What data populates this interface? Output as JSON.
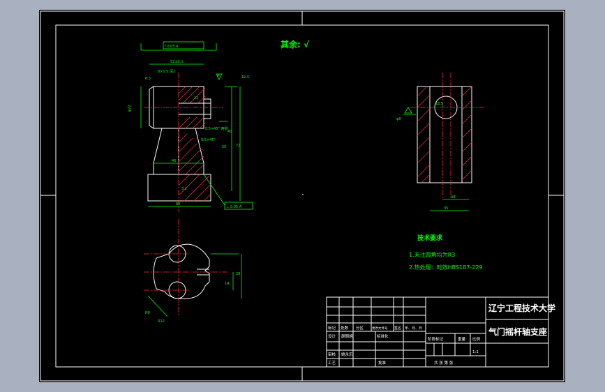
{
  "roughness_note": "其余: √",
  "tech_req": {
    "title": "技术要求",
    "items": [
      "1.未注圆角均为R3",
      "2.热处理：时效HBS187-229"
    ]
  },
  "dims": {
    "flatness": "f 0.05 A",
    "perp": "⊥ 0.05 A",
    "width_top": "52±0.1",
    "hole_note": "8×0.5 深2",
    "chamfer_note": "0.5×45° 两侧",
    "groove_note": "0.5×45°",
    "ra_top": "12.5",
    "dim_phi": "φ22",
    "dim_12": "12",
    "dim_40": "40",
    "dim_50": "50",
    "dim_72": "72",
    "dim_46": "46",
    "dim_80": "80",
    "dim_3_2": "3.2",
    "dim_6_3": "6.3",
    "dim_r": "R11",
    "side_phi": "φ8",
    "side_12_5": "12.5",
    "side_44": "44",
    "side_35": "35",
    "plan_28": "28",
    "plan_14": "14",
    "plan_r9": "R9",
    "plan_r12": "R12"
  },
  "title_block": {
    "school": "辽宁工程技术大学",
    "part_name": "气门摇杆轴支座",
    "row_labels": [
      "标记",
      "处数",
      "分区",
      "更改文件号",
      "签名",
      "年、月、日"
    ],
    "design_label": "设计",
    "designer": "颜朝旭",
    "standard_label": "标准化",
    "review_label": "审核",
    "reviewer": "姚永乐",
    "process_label": "工艺",
    "approve_label": "批准",
    "stage_labels": [
      "阶段标记",
      "重量",
      "比例"
    ],
    "scale": "1:1",
    "sheet_note": "共 张 第 张"
  }
}
